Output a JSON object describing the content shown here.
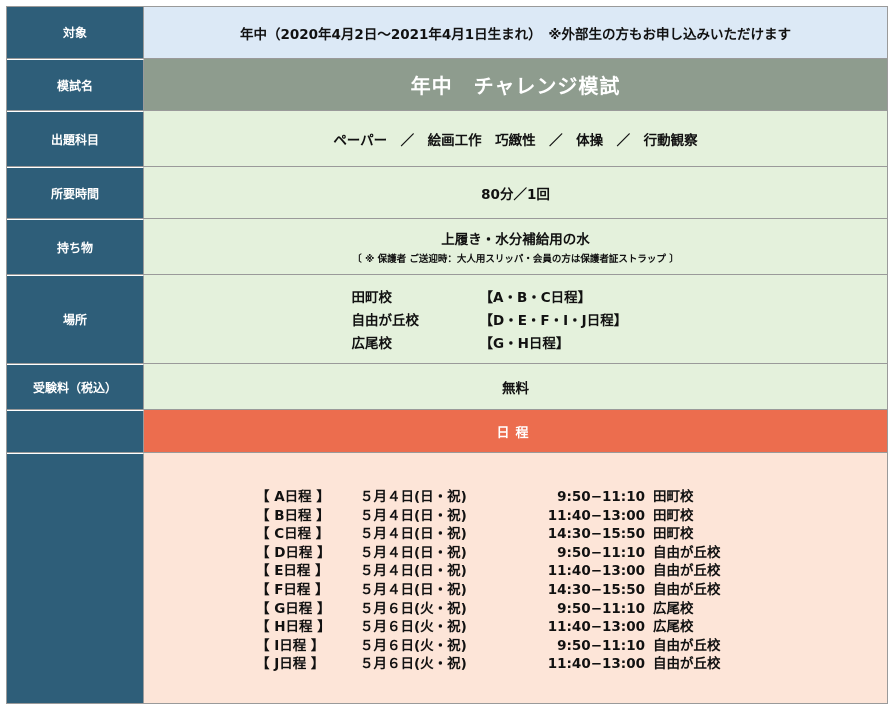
{
  "rows": {
    "target": {
      "label": "対象",
      "value": "年中（2020年4月2日～2021年4月1日生まれ）　※外部生の方もお申し込みいただけます"
    },
    "exam_name": {
      "label": "模試名",
      "value": "年中　チャレンジ模試"
    },
    "subjects": {
      "label": "出題科目",
      "value": "ペーパー　／　絵画工作　巧緻性　／　体操　／　行動観察"
    },
    "duration": {
      "label": "所要時間",
      "value": "80分／1回"
    },
    "belongings": {
      "label": "持ち物",
      "value": "上履き・水分補給用の水",
      "note": "〔 ※ 保護者 ご送迎時：大人用スリッパ・会員の方は保護者証ストラップ 〕"
    },
    "venue": {
      "label": "場所",
      "items": [
        {
          "school": "田町校",
          "schedule": "【A・B・C日程】"
        },
        {
          "school": "自由が丘校",
          "schedule": "【D・E・F・I・J日程】"
        },
        {
          "school": "広尾校",
          "schedule": "【G・H日程】"
        }
      ]
    },
    "fee": {
      "label": "受験料（税込）",
      "value": "無料"
    },
    "schedule_header": {
      "label": "",
      "value": "日程"
    },
    "schedule": {
      "label": "",
      "items": [
        {
          "code": "【 A日程 】",
          "date": "５月４日(日・祝)",
          "time": "9:50−11:10",
          "place": "田町校"
        },
        {
          "code": "【 B日程 】",
          "date": "５月４日(日・祝)",
          "time": "11:40−13:00",
          "place": "田町校"
        },
        {
          "code": "【 C日程 】",
          "date": "５月４日(日・祝)",
          "time": "14:30−15:50",
          "place": "田町校"
        },
        {
          "code": "【 D日程 】",
          "date": "５月４日(日・祝)",
          "time": "9:50−11:10",
          "place": "自由が丘校"
        },
        {
          "code": "【 E日程 】",
          "date": "５月４日(日・祝)",
          "time": "11:40−13:00",
          "place": "自由が丘校"
        },
        {
          "code": "【 F日程 】",
          "date": "５月４日(日・祝)",
          "time": "14:30−15:50",
          "place": "自由が丘校"
        },
        {
          "code": "【 G日程 】",
          "date": "５月６日(火・祝)",
          "time": "9:50−11:10",
          "place": "広尾校"
        },
        {
          "code": "【 H日程 】",
          "date": "５月６日(火・祝)",
          "time": "11:40−13:00",
          "place": "広尾校"
        },
        {
          "code": "【 I日程 】",
          "date": "５月６日(火・祝)",
          "time": "9:50−11:10",
          "place": "自由が丘校"
        },
        {
          "code": "【 J日程 】",
          "date": "５月６日(火・祝)",
          "time": "11:40−13:00",
          "place": "自由が丘校"
        }
      ]
    }
  }
}
